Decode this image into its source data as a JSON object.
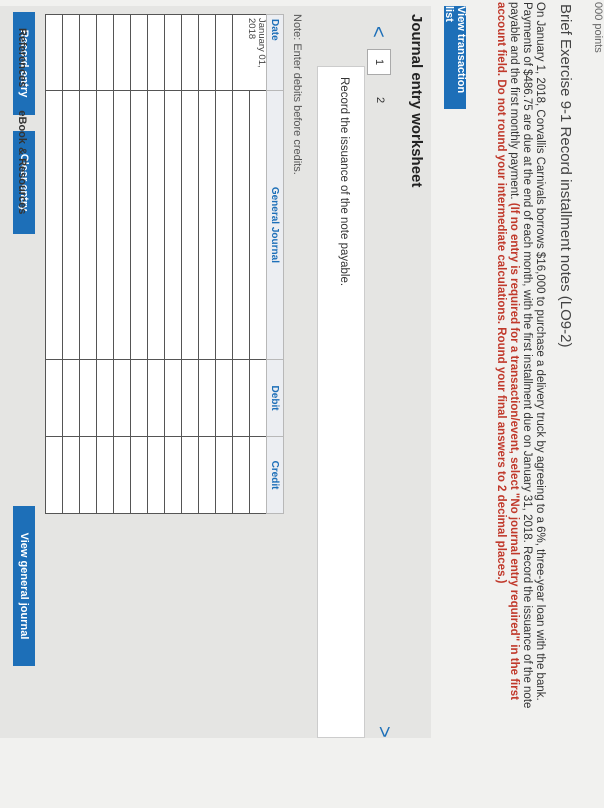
{
  "points": "000 points",
  "exercise_title": "Brief Exercise 9-1 Record installment notes (LO9-2)",
  "problem_text": "On January 1, 2018, Corvallis Carnivals borrows $16,000 to purchase a delivery truck by agreeing to a 6%, three-year loan with the bank. Payments of $486.75 are due at the end of each month, with the first installment due on January 31, 2018. Record the issuance of the note payable and the first monthly payment.",
  "problem_red": "(If no entry is required for a transaction/event, select \"No journal entry required\" in the first account field. Do not round your intermediate calculations. Round your final answers to 2 decimal places.)",
  "view_transaction_list": "View transaction list",
  "worksheet": {
    "title": "Journal entry worksheet",
    "prev": "<",
    "next": ">",
    "tabs": [
      "1",
      "2"
    ],
    "instruction": "Record the issuance of the note payable.",
    "note": "Note: Enter debits before credits.",
    "columns": {
      "date": "Date",
      "journal": "General Journal",
      "debit": "Debit",
      "credit": "Credit"
    },
    "first_date": "January 01, 2018"
  },
  "buttons": {
    "record": "Record entry",
    "clear": "Clear entry",
    "view_gj": "View general journal"
  },
  "links": {
    "references": "References",
    "ebook": "eBook & Resources"
  }
}
